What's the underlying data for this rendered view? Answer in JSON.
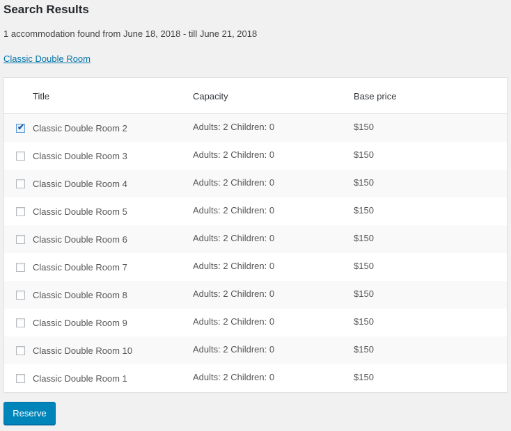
{
  "page": {
    "title": "Search Results",
    "summary": "1 accommodation found from June 18, 2018 - till June 21, 2018",
    "accommodation_link": "Classic Double Room"
  },
  "table": {
    "headers": {
      "title": "Title",
      "capacity": "Capacity",
      "base_price": "Base price"
    },
    "rows": [
      {
        "title": "Classic Double Room 2",
        "capacity": "Adults: 2 Children: 0",
        "price": "$150",
        "checked": true
      },
      {
        "title": "Classic Double Room 3",
        "capacity": "Adults: 2 Children: 0",
        "price": "$150",
        "checked": false
      },
      {
        "title": "Classic Double Room 4",
        "capacity": "Adults: 2 Children: 0",
        "price": "$150",
        "checked": false
      },
      {
        "title": "Classic Double Room 5",
        "capacity": "Adults: 2 Children: 0",
        "price": "$150",
        "checked": false
      },
      {
        "title": "Classic Double Room 6",
        "capacity": "Adults: 2 Children: 0",
        "price": "$150",
        "checked": false
      },
      {
        "title": "Classic Double Room 7",
        "capacity": "Adults: 2 Children: 0",
        "price": "$150",
        "checked": false
      },
      {
        "title": "Classic Double Room 8",
        "capacity": "Adults: 2 Children: 0",
        "price": "$150",
        "checked": false
      },
      {
        "title": "Classic Double Room 9",
        "capacity": "Adults: 2 Children: 0",
        "price": "$150",
        "checked": false
      },
      {
        "title": "Classic Double Room 10",
        "capacity": "Adults: 2 Children: 0",
        "price": "$150",
        "checked": false
      },
      {
        "title": "Classic Double Room 1",
        "capacity": "Adults: 2 Children: 0",
        "price": "$150",
        "checked": false
      }
    ]
  },
  "actions": {
    "reserve_label": "Reserve"
  },
  "colors": {
    "accent": "#0085ba",
    "link": "#0073aa"
  }
}
